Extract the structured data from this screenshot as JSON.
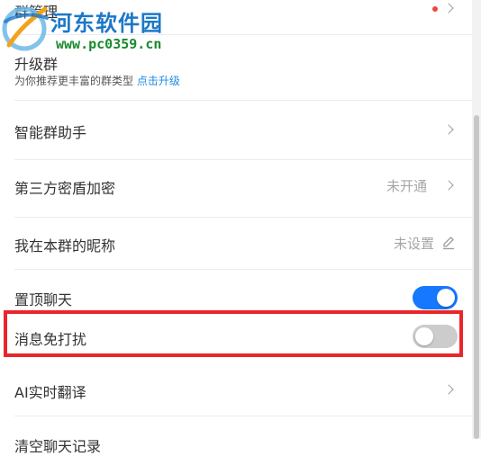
{
  "watermark": {
    "title": "河东软件园",
    "url": "www.pc0359.cn"
  },
  "settings": {
    "group_manage": {
      "label": "群管理"
    },
    "upgrade": {
      "label": "升级群",
      "desc": "为你推荐更丰富的群类型",
      "link": "点击升级"
    },
    "smart_assistant": {
      "label": "智能群助手"
    },
    "third_party_shield": {
      "label": "第三方密盾加密",
      "value": "未开通"
    },
    "my_nickname": {
      "label": "我在本群的昵称",
      "value": "未设置"
    },
    "pin_chat": {
      "label": "置顶聊天",
      "enabled": true
    },
    "do_not_disturb": {
      "label": "消息免打扰",
      "enabled": false
    },
    "ai_translate": {
      "label": "AI实时翻译"
    },
    "clear_history": {
      "label": "清空聊天记录"
    }
  },
  "colors": {
    "accent_blue": "#1677ff",
    "toggle_off": "#cccccc",
    "highlight_red": "#e8262b",
    "badge_red": "#f0463c",
    "link_blue": "#1e8ce6",
    "watermark_blue": "#1b78c7",
    "watermark_green": "#1b8a2e"
  },
  "icons": {
    "chevron": "chevron-right-icon",
    "edit": "pencil-edit-icon",
    "logo": "hedong-logo-icon"
  }
}
